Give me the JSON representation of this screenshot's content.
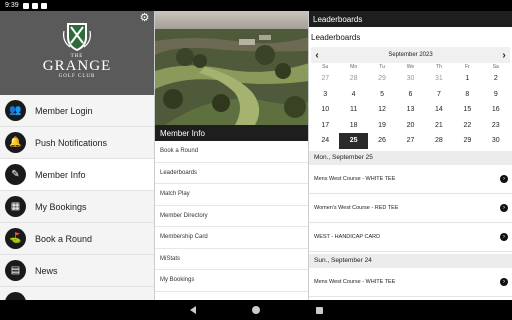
{
  "status_bar": {
    "time": "9:39"
  },
  "brand": {
    "line1": "THE",
    "line2": "GRANGE",
    "line3": "GOLF CLUB"
  },
  "sidebar": {
    "items": [
      {
        "label": "Member Login",
        "icon": "users-icon",
        "glyph": "👥"
      },
      {
        "label": "Push Notifications",
        "icon": "bell-icon",
        "glyph": "🔔"
      },
      {
        "label": "Member Info",
        "icon": "edit-icon",
        "glyph": "✎"
      },
      {
        "label": "My Bookings",
        "icon": "calendar-icon",
        "glyph": "▦"
      },
      {
        "label": "Book a Round",
        "icon": "golfer-icon",
        "glyph": "⛳"
      },
      {
        "label": "News",
        "icon": "newspaper-icon",
        "glyph": "▤"
      },
      {
        "label": "",
        "icon": "more-icon",
        "glyph": "•"
      }
    ]
  },
  "member_info": {
    "title": "Member Info",
    "items": [
      "Book a Round",
      "Leaderboards",
      "Match Play",
      "Member Directory",
      "Membership Card",
      "MiStats",
      "My Bookings"
    ]
  },
  "leaderboards": {
    "title": "Leaderboards",
    "subtitle": "Leaderboards",
    "calendar": {
      "month": "September 2023",
      "dow": [
        "Su",
        "Mo",
        "Tu",
        "We",
        "Th",
        "Fr",
        "Sa"
      ],
      "days": [
        [
          "27",
          "28",
          "29",
          "30",
          "31",
          "1",
          "2"
        ],
        [
          "3",
          "4",
          "5",
          "6",
          "7",
          "8",
          "9"
        ],
        [
          "10",
          "11",
          "12",
          "13",
          "14",
          "15",
          "16"
        ],
        [
          "17",
          "18",
          "19",
          "20",
          "21",
          "22",
          "23"
        ],
        [
          "24",
          "25",
          "26",
          "27",
          "28",
          "29",
          "30"
        ]
      ],
      "selected": "25"
    },
    "sections": [
      {
        "heading": "Mon., September 25",
        "events": [
          "Mens West Course - WHITE TEE",
          "Women's West Course - RED TEE",
          "WEST - HANDICAP CARD"
        ]
      },
      {
        "heading": "Sun., September 24",
        "events": [
          "Mens West Course - WHITE TEE"
        ]
      }
    ]
  }
}
